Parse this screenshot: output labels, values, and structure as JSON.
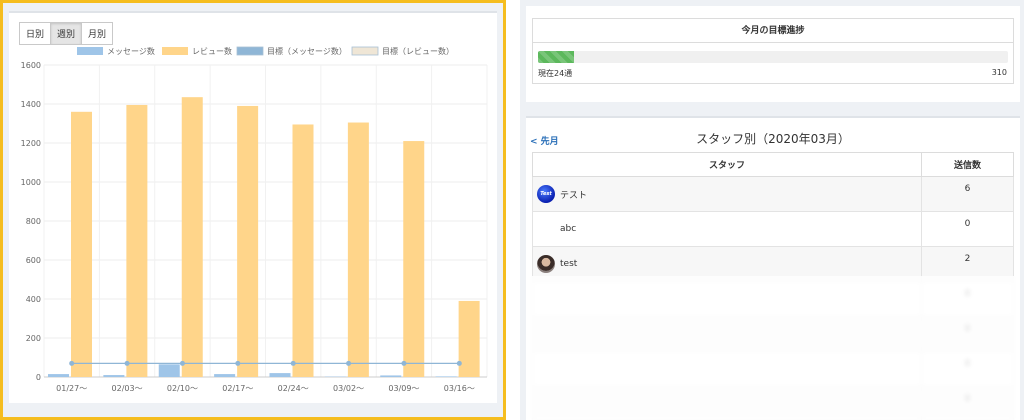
{
  "period_tabs": [
    {
      "label": "日別",
      "active": false
    },
    {
      "label": "週別",
      "active": true
    },
    {
      "label": "月別",
      "active": false
    }
  ],
  "chart_data": {
    "type": "bar",
    "categories": [
      "01/27〜",
      "02/03〜",
      "02/10〜",
      "02/17〜",
      "02/24〜",
      "03/02〜",
      "03/09〜",
      "03/16〜"
    ],
    "series": [
      {
        "name": "メッセージ数",
        "type": "bar",
        "color": "#9fc5e8",
        "values": [
          15,
          10,
          65,
          15,
          20,
          2,
          8,
          3
        ]
      },
      {
        "name": "レビュー数",
        "type": "bar",
        "color": "#ffd58a",
        "values": [
          1360,
          1395,
          1435,
          1390,
          1295,
          1305,
          1210,
          390
        ]
      },
      {
        "name": "目標（メッセージ数）",
        "type": "line",
        "color": "#8fb6d6",
        "values": [
          70,
          70,
          70,
          70,
          70,
          70,
          70,
          70
        ]
      },
      {
        "name": "目標（レビュー数）",
        "type": "line",
        "color": "#efe6d6",
        "values": []
      }
    ],
    "yticks": [
      0,
      200,
      400,
      600,
      800,
      1000,
      1200,
      1400,
      1600
    ],
    "ylim": [
      0,
      1600
    ],
    "grid": true,
    "legend": "top"
  },
  "goal": {
    "title": "今月の目標進捗",
    "current_label": "現在24通",
    "target_label": "310",
    "progress": 0.077
  },
  "staff": {
    "prev_label": "< 先月",
    "title": "スタッフ別（2020年03月）",
    "col_staff": "スタッフ",
    "col_count": "送信数",
    "rows": [
      {
        "name": "テスト",
        "count": "6",
        "avatar": "blue-test-avatar"
      },
      {
        "name": "abc",
        "count": "0",
        "avatar": "none"
      },
      {
        "name": "test",
        "count": "2",
        "avatar": "photo-avatar"
      },
      {
        "name": "",
        "count": "0",
        "avatar": "none"
      },
      {
        "name": "",
        "count": "0",
        "avatar": "none"
      },
      {
        "name": "",
        "count": "0",
        "avatar": "none"
      },
      {
        "name": "",
        "count": "0",
        "avatar": "none"
      }
    ]
  }
}
